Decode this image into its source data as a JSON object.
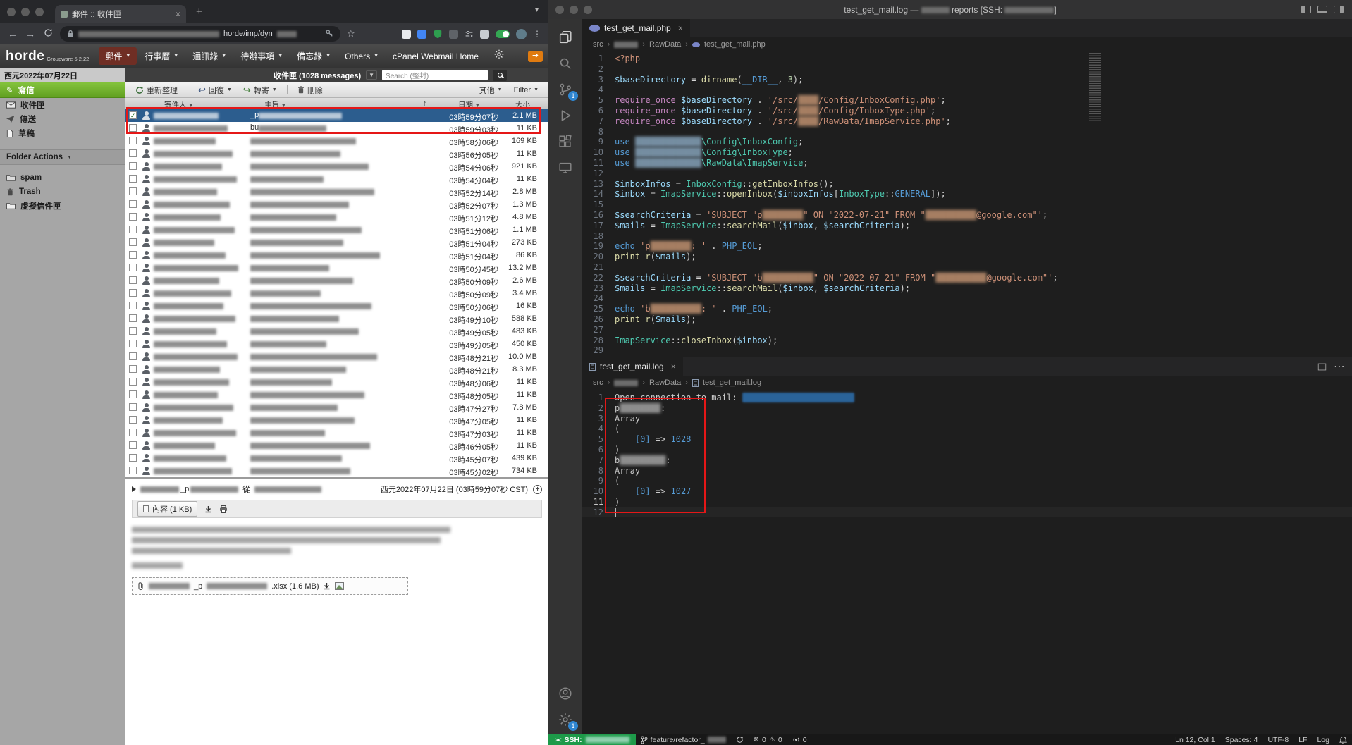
{
  "colors": {
    "annotation": "#e51717",
    "compose_green": "#76b82a",
    "selected_row": "#2c5d8e",
    "status_green": "#1d9a49",
    "badge_blue": "#2f86d1"
  },
  "browser": {
    "tab_title": "郵件 :: 收件匣",
    "url_visible": "horde/imp/dyn",
    "horde": {
      "logo": "horde",
      "logo_sub": "Groupware 5.2.22",
      "menu": [
        {
          "label": "郵件"
        },
        {
          "label": "行事曆"
        },
        {
          "label": "通訊錄"
        },
        {
          "label": "待辦事項"
        },
        {
          "label": "備忘錄"
        },
        {
          "label": "Others"
        },
        {
          "label": "cPanel Webmail Home"
        }
      ],
      "date": "西元2022年07月22日",
      "mailbox_label": "收件匣 (1028 messages)",
      "search_placeholder": "Search (整封)",
      "toolbar": {
        "refresh": "重新整理",
        "reply": "回復",
        "forward": "轉寄",
        "delete": "刪除",
        "other": "其他",
        "filter": "Filter"
      },
      "columns": {
        "sender": "寄件人",
        "subject": "主旨",
        "sort_arrow": "↑",
        "date": "日期",
        "size": "大小"
      },
      "sidebar": {
        "compose": "寫信",
        "inbox": "收件匣",
        "sent": "傳送",
        "drafts": "草稿",
        "folder_actions": "Folder Actions",
        "spam": "spam",
        "trash": "Trash",
        "virtual": "虛擬信件匣"
      },
      "rows": [
        {
          "time": "03時59分07秒",
          "size": "2.1 MB",
          "selected": true,
          "checked": true,
          "subject_prefix": "_p",
          "sender_w": 92,
          "subject_w": 118
        },
        {
          "time": "03時59分03秒",
          "size": "11 KB",
          "subject_prefix": "bu",
          "sender_w": 105,
          "subject_w": 96
        },
        {
          "time": "03時58分06秒",
          "size": "169 KB",
          "sender_w": 88,
          "subject_w": 150
        },
        {
          "time": "03時56分05秒",
          "size": "11 KB",
          "sender_w": 112,
          "subject_w": 128
        },
        {
          "time": "03時54分06秒",
          "size": "921 KB",
          "sender_w": 97,
          "subject_w": 168
        },
        {
          "time": "03時54分04秒",
          "size": "11 KB",
          "sender_w": 118,
          "subject_w": 104
        },
        {
          "time": "03時52分14秒",
          "size": "2.8 MB",
          "sender_w": 90,
          "subject_w": 176
        },
        {
          "time": "03時52分07秒",
          "size": "1.3 MB",
          "sender_w": 108,
          "subject_w": 140
        },
        {
          "time": "03時51分12秒",
          "size": "4.8 MB",
          "sender_w": 95,
          "subject_w": 122
        },
        {
          "time": "03時51分06秒",
          "size": "1.1 MB",
          "sender_w": 115,
          "subject_w": 158
        },
        {
          "time": "03時51分04秒",
          "size": "273 KB",
          "sender_w": 86,
          "subject_w": 132
        },
        {
          "time": "03時51分04秒",
          "size": "86 KB",
          "sender_w": 102,
          "subject_w": 184
        },
        {
          "time": "03時50分45秒",
          "size": "13.2 MB",
          "sender_w": 120,
          "subject_w": 112
        },
        {
          "time": "03時50分09秒",
          "size": "2.6 MB",
          "sender_w": 93,
          "subject_w": 146
        },
        {
          "time": "03時50分09秒",
          "size": "3.4 MB",
          "sender_w": 110,
          "subject_w": 100
        },
        {
          "time": "03時50分06秒",
          "size": "16 KB",
          "sender_w": 99,
          "subject_w": 172
        },
        {
          "time": "03時49分10秒",
          "size": "588 KB",
          "sender_w": 116,
          "subject_w": 126
        },
        {
          "time": "03時49分05秒",
          "size": "483 KB",
          "sender_w": 89,
          "subject_w": 154
        },
        {
          "time": "03時49分05秒",
          "size": "450 KB",
          "sender_w": 104,
          "subject_w": 108
        },
        {
          "time": "03時48分21秒",
          "size": "10.0 MB",
          "sender_w": 119,
          "subject_w": 180
        },
        {
          "time": "03時48分21秒",
          "size": "8.3 MB",
          "sender_w": 94,
          "subject_w": 136
        },
        {
          "time": "03時48分06秒",
          "size": "11 KB",
          "sender_w": 107,
          "subject_w": 116
        },
        {
          "time": "03時48分05秒",
          "size": "11 KB",
          "sender_w": 91,
          "subject_w": 162
        },
        {
          "time": "03時47分27秒",
          "size": "7.8 MB",
          "sender_w": 113,
          "subject_w": 124
        },
        {
          "time": "03時47分05秒",
          "size": "11 KB",
          "sender_w": 98,
          "subject_w": 148
        },
        {
          "time": "03時47分03秒",
          "size": "11 KB",
          "sender_w": 117,
          "subject_w": 106
        },
        {
          "time": "03時46分05秒",
          "size": "11 KB",
          "sender_w": 87,
          "subject_w": 170
        },
        {
          "time": "03時45分07秒",
          "size": "439 KB",
          "sender_w": 103,
          "subject_w": 130
        },
        {
          "time": "03時45分02秒",
          "size": "734 KB",
          "sender_w": 111,
          "subject_w": 142
        }
      ],
      "preview": {
        "name_fragment": "_p",
        "from_label": "從",
        "date": "西元2022年07月22日 (03時59分07秒 CST)",
        "content_button": "內容 (1 KB)",
        "attachment_fragment": "_p",
        "attachment_suffix": ".xlsx (1.6 MB)"
      }
    }
  },
  "vscode": {
    "title": {
      "prefix": "test_get_mail.log — ",
      "mid": " reports [SSH: ",
      "suffix": "]"
    },
    "activity": {
      "scm_badge": "1",
      "manage_badge": "1"
    },
    "editor": {
      "tab": "test_get_mail.php",
      "crumb_root": "src",
      "crumb_dir": "RawData",
      "crumb_file": "test_get_mail.php",
      "lines": [
        [
          [
            "tag",
            "<?php"
          ]
        ],
        [],
        [
          [
            "var",
            "$baseDirectory"
          ],
          [
            "pun",
            " = "
          ],
          [
            "fn",
            "dirname"
          ],
          [
            "pun",
            "("
          ],
          [
            "const",
            "__DIR__"
          ],
          [
            "pun",
            ", "
          ],
          [
            "num",
            "3"
          ],
          [
            "pun",
            ");"
          ]
        ],
        [],
        [
          [
            "kwp",
            "require_once"
          ],
          [
            "pun",
            " "
          ],
          [
            "var",
            "$baseDirectory"
          ],
          [
            "pun",
            " . "
          ],
          [
            "str",
            "'/src/"
          ],
          [
            "bluro",
            "████"
          ],
          [
            "str",
            "/Config/InboxConfig.php'"
          ],
          [
            "pun",
            ";"
          ]
        ],
        [
          [
            "kwp",
            "require_once"
          ],
          [
            "pun",
            " "
          ],
          [
            "var",
            "$baseDirectory"
          ],
          [
            "pun",
            " . "
          ],
          [
            "str",
            "'/src/"
          ],
          [
            "bluro",
            "████"
          ],
          [
            "str",
            "/Config/InboxType.php'"
          ],
          [
            "pun",
            ";"
          ]
        ],
        [
          [
            "kwp",
            "require_once"
          ],
          [
            "pun",
            " "
          ],
          [
            "var",
            "$baseDirectory"
          ],
          [
            "pun",
            " . "
          ],
          [
            "str",
            "'/src/"
          ],
          [
            "bluro",
            "████"
          ],
          [
            "str",
            "/RawData/ImapService.php'"
          ],
          [
            "pun",
            ";"
          ]
        ],
        [],
        [
          [
            "kwb",
            "use"
          ],
          [
            "pun",
            " "
          ],
          [
            "blurb",
            "█████████████"
          ],
          [
            "cls",
            "\\Config\\InboxConfig"
          ],
          [
            "pun",
            ";"
          ]
        ],
        [
          [
            "kwb",
            "use"
          ],
          [
            "pun",
            " "
          ],
          [
            "blurb",
            "█████████████"
          ],
          [
            "cls",
            "\\Config\\InboxType"
          ],
          [
            "pun",
            ";"
          ]
        ],
        [
          [
            "kwb",
            "use"
          ],
          [
            "pun",
            " "
          ],
          [
            "blurb",
            "█████████████"
          ],
          [
            "cls",
            "\\RawData\\ImapService"
          ],
          [
            "pun",
            ";"
          ]
        ],
        [],
        [
          [
            "var",
            "$inboxInfos"
          ],
          [
            "pun",
            " = "
          ],
          [
            "cls",
            "InboxConfig"
          ],
          [
            "pun",
            "::"
          ],
          [
            "fn",
            "getInboxInfos"
          ],
          [
            "pun",
            "();"
          ]
        ],
        [
          [
            "var",
            "$inbox"
          ],
          [
            "pun",
            " = "
          ],
          [
            "cls",
            "ImapService"
          ],
          [
            "pun",
            "::"
          ],
          [
            "fn",
            "openInbox"
          ],
          [
            "pun",
            "("
          ],
          [
            "var",
            "$inboxInfos"
          ],
          [
            "pun",
            "["
          ],
          [
            "cls",
            "InboxType"
          ],
          [
            "pun",
            "::"
          ],
          [
            "const",
            "GENERAL"
          ],
          [
            "pun",
            "]);"
          ]
        ],
        [],
        [
          [
            "var",
            "$searchCriteria"
          ],
          [
            "pun",
            " = "
          ],
          [
            "str",
            "'SUBJECT \"p"
          ],
          [
            "bluro",
            "████████"
          ],
          [
            "str",
            "\" ON \"2022-07-21\" FROM \""
          ],
          [
            "bluro",
            "██████████"
          ],
          [
            "str",
            "@google.com\"'"
          ],
          [
            "pun",
            ";"
          ]
        ],
        [
          [
            "var",
            "$mails"
          ],
          [
            "pun",
            " = "
          ],
          [
            "cls",
            "ImapService"
          ],
          [
            "pun",
            "::"
          ],
          [
            "fn",
            "searchMail"
          ],
          [
            "pun",
            "("
          ],
          [
            "var",
            "$inbox"
          ],
          [
            "pun",
            ", "
          ],
          [
            "var",
            "$searchCriteria"
          ],
          [
            "pun",
            ");"
          ]
        ],
        [],
        [
          [
            "kwb",
            "echo"
          ],
          [
            "pun",
            " "
          ],
          [
            "str",
            "'p"
          ],
          [
            "bluro",
            "████████"
          ],
          [
            "str",
            ": '"
          ],
          [
            "pun",
            " . "
          ],
          [
            "const",
            "PHP_EOL"
          ],
          [
            "pun",
            ";"
          ]
        ],
        [
          [
            "fn",
            "print_r"
          ],
          [
            "pun",
            "("
          ],
          [
            "var",
            "$mails"
          ],
          [
            "pun",
            ");"
          ]
        ],
        [],
        [
          [
            "var",
            "$searchCriteria"
          ],
          [
            "pun",
            " = "
          ],
          [
            "str",
            "'SUBJECT \"b"
          ],
          [
            "bluro",
            "██████████"
          ],
          [
            "str",
            "\" ON \"2022-07-21\" FROM \""
          ],
          [
            "bluro",
            "██████████"
          ],
          [
            "str",
            "@google.com\"'"
          ],
          [
            "pun",
            ";"
          ]
        ],
        [
          [
            "var",
            "$mails"
          ],
          [
            "pun",
            " = "
          ],
          [
            "cls",
            "ImapService"
          ],
          [
            "pun",
            "::"
          ],
          [
            "fn",
            "searchMail"
          ],
          [
            "pun",
            "("
          ],
          [
            "var",
            "$inbox"
          ],
          [
            "pun",
            ", "
          ],
          [
            "var",
            "$searchCriteria"
          ],
          [
            "pun",
            ");"
          ]
        ],
        [],
        [
          [
            "kwb",
            "echo"
          ],
          [
            "pun",
            " "
          ],
          [
            "str",
            "'b"
          ],
          [
            "bluro",
            "██████████"
          ],
          [
            "str",
            ": '"
          ],
          [
            "pun",
            " . "
          ],
          [
            "const",
            "PHP_EOL"
          ],
          [
            "pun",
            ";"
          ]
        ],
        [
          [
            "fn",
            "print_r"
          ],
          [
            "pun",
            "("
          ],
          [
            "var",
            "$mails"
          ],
          [
            "pun",
            ");"
          ]
        ],
        [],
        [
          [
            "cls",
            "ImapService"
          ],
          [
            "pun",
            "::"
          ],
          [
            "fn",
            "closeInbox"
          ],
          [
            "pun",
            "("
          ],
          [
            "var",
            "$inbox"
          ],
          [
            "pun",
            ");"
          ]
        ],
        []
      ]
    },
    "panel": {
      "tab": "test_get_mail.log",
      "crumb_root": "src",
      "crumb_dir": "RawData",
      "crumb_file": "test_get_mail.log",
      "lines": [
        [
          [
            "txt",
            "Open connection to mail: "
          ],
          [
            "blursel",
            "                      "
          ]
        ],
        [
          [
            "txt",
            "p"
          ],
          [
            "blur",
            "████████"
          ],
          [
            "txt",
            ":"
          ]
        ],
        [
          [
            "txt",
            "Array"
          ]
        ],
        [
          [
            "txt",
            "("
          ]
        ],
        [
          [
            "txt",
            "    "
          ],
          [
            "lognum",
            "[0]"
          ],
          [
            "txt",
            " => "
          ],
          [
            "lognum",
            "1028"
          ]
        ],
        [
          [
            "txt",
            ")"
          ]
        ],
        [
          [
            "txt",
            "b"
          ],
          [
            "blur",
            "█████████"
          ],
          [
            "txt",
            ":"
          ]
        ],
        [
          [
            "txt",
            "Array"
          ]
        ],
        [
          [
            "txt",
            "("
          ]
        ],
        [
          [
            "txt",
            "    "
          ],
          [
            "lognum",
            "[0]"
          ],
          [
            "txt",
            " => "
          ],
          [
            "lognum",
            "1027"
          ]
        ],
        [
          [
            "txt",
            ")"
          ]
        ],
        []
      ]
    },
    "status": {
      "ssh_label": "SSH:",
      "branch": "feature/refactor_",
      "errors": "0",
      "warnings": "0",
      "ports": "0",
      "cursor": "Ln 12, Col 1",
      "spaces": "Spaces: 4",
      "encoding": "UTF-8",
      "eol": "LF",
      "language": "Log"
    }
  }
}
